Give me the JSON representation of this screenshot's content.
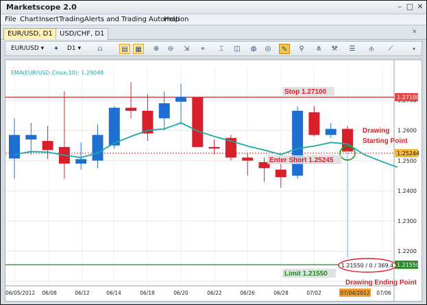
{
  "window": {
    "title": "Marketscope 2.0"
  },
  "menu": [
    "File",
    "Chart",
    "Insert",
    "Trading",
    "Alerts and Trading Automation",
    "Help"
  ],
  "tabs": [
    {
      "label": "EUR/USD, D1",
      "active": true
    },
    {
      "label": "USD/CHF, D1",
      "active": false
    }
  ],
  "toolbar": {
    "symbol": "EUR/USD",
    "timeframe": "D1"
  },
  "indicator_label": "EMA(EUR/USD.Close,10): 1.29048",
  "annotations": {
    "stop": "Stop 1.27100",
    "enter": "Enter Short 1.25245",
    "limit": "Limit 1.21550",
    "start_line1": "Drawing",
    "start_line2": "Starting Point",
    "end": "Drawing Ending Point",
    "readout": "1.21550 / 0 / 369.4"
  },
  "price_tags": {
    "stop": "1.27100",
    "enter": "1.25244",
    "limit": "1.21550"
  },
  "colors": {
    "bull": "#1f6fd1",
    "bear": "#d9202a",
    "ema": "#1aa8a8",
    "stop": "#d9202a",
    "limit": "#1a8a1a",
    "accent": "#d9202a"
  },
  "chart_data": {
    "type": "candlestick",
    "y_ticks": [
      "1.2700",
      "1.2600",
      "1.2500",
      "1.2400",
      "1.2300",
      "1.2200"
    ],
    "x_ticks": [
      "06/05/2012",
      "06/08",
      "06/12",
      "06/14",
      "06/18",
      "06/20",
      "06/22",
      "06/26",
      "06/28",
      "07/02",
      "07/04/2012",
      "07/06"
    ],
    "ylim": [
      1.2085,
      1.281
    ],
    "candles": [
      {
        "o": 1.2507,
        "h": 1.264,
        "l": 1.244,
        "c": 1.2585
      },
      {
        "o": 1.257,
        "h": 1.2625,
        "l": 1.252,
        "c": 1.2585
      },
      {
        "o": 1.2565,
        "h": 1.2615,
        "l": 1.2505,
        "c": 1.2535
      },
      {
        "o": 1.2545,
        "h": 1.273,
        "l": 1.244,
        "c": 1.249
      },
      {
        "o": 1.249,
        "h": 1.256,
        "l": 1.247,
        "c": 1.2505
      },
      {
        "o": 1.25,
        "h": 1.262,
        "l": 1.2475,
        "c": 1.2585
      },
      {
        "o": 1.255,
        "h": 1.268,
        "l": 1.254,
        "c": 1.2675
      },
      {
        "o": 1.2675,
        "h": 1.276,
        "l": 1.264,
        "c": 1.2665
      },
      {
        "o": 1.2665,
        "h": 1.272,
        "l": 1.2565,
        "c": 1.259
      },
      {
        "o": 1.264,
        "h": 1.273,
        "l": 1.26,
        "c": 1.269
      },
      {
        "o": 1.2695,
        "h": 1.2755,
        "l": 1.262,
        "c": 1.271
      },
      {
        "o": 1.271,
        "h": 1.271,
        "l": 1.256,
        "c": 1.2545
      },
      {
        "o": 1.2545,
        "h": 1.257,
        "l": 1.252,
        "c": 1.254
      },
      {
        "o": 1.2575,
        "h": 1.2585,
        "l": 1.25,
        "c": 1.251
      },
      {
        "o": 1.251,
        "h": 1.2525,
        "l": 1.245,
        "c": 1.25
      },
      {
        "o": 1.2495,
        "h": 1.251,
        "l": 1.243,
        "c": 1.2475
      },
      {
        "o": 1.247,
        "h": 1.249,
        "l": 1.241,
        "c": 1.2445
      },
      {
        "o": 1.245,
        "h": 1.268,
        "l": 1.244,
        "c": 1.2665
      },
      {
        "o": 1.266,
        "h": 1.268,
        "l": 1.258,
        "c": 1.2585
      },
      {
        "o": 1.2585,
        "h": 1.2625,
        "l": 1.2575,
        "c": 1.2605
      },
      {
        "o": 1.2605,
        "h": 1.2615,
        "l": 1.252,
        "c": 1.253
      }
    ],
    "ema": [
      1.252,
      1.253,
      1.2528,
      1.2518,
      1.251,
      1.2525,
      1.2558,
      1.258,
      1.26,
      1.2605,
      1.2625,
      1.2598,
      1.258,
      1.2565,
      1.2548,
      1.2535,
      1.252,
      1.254,
      1.2548,
      1.256,
      1.2555,
      1.252,
      1.2498,
      1.2478
    ],
    "levels": {
      "stop": 1.271,
      "enter": 1.25245,
      "limit": 1.2155
    }
  }
}
